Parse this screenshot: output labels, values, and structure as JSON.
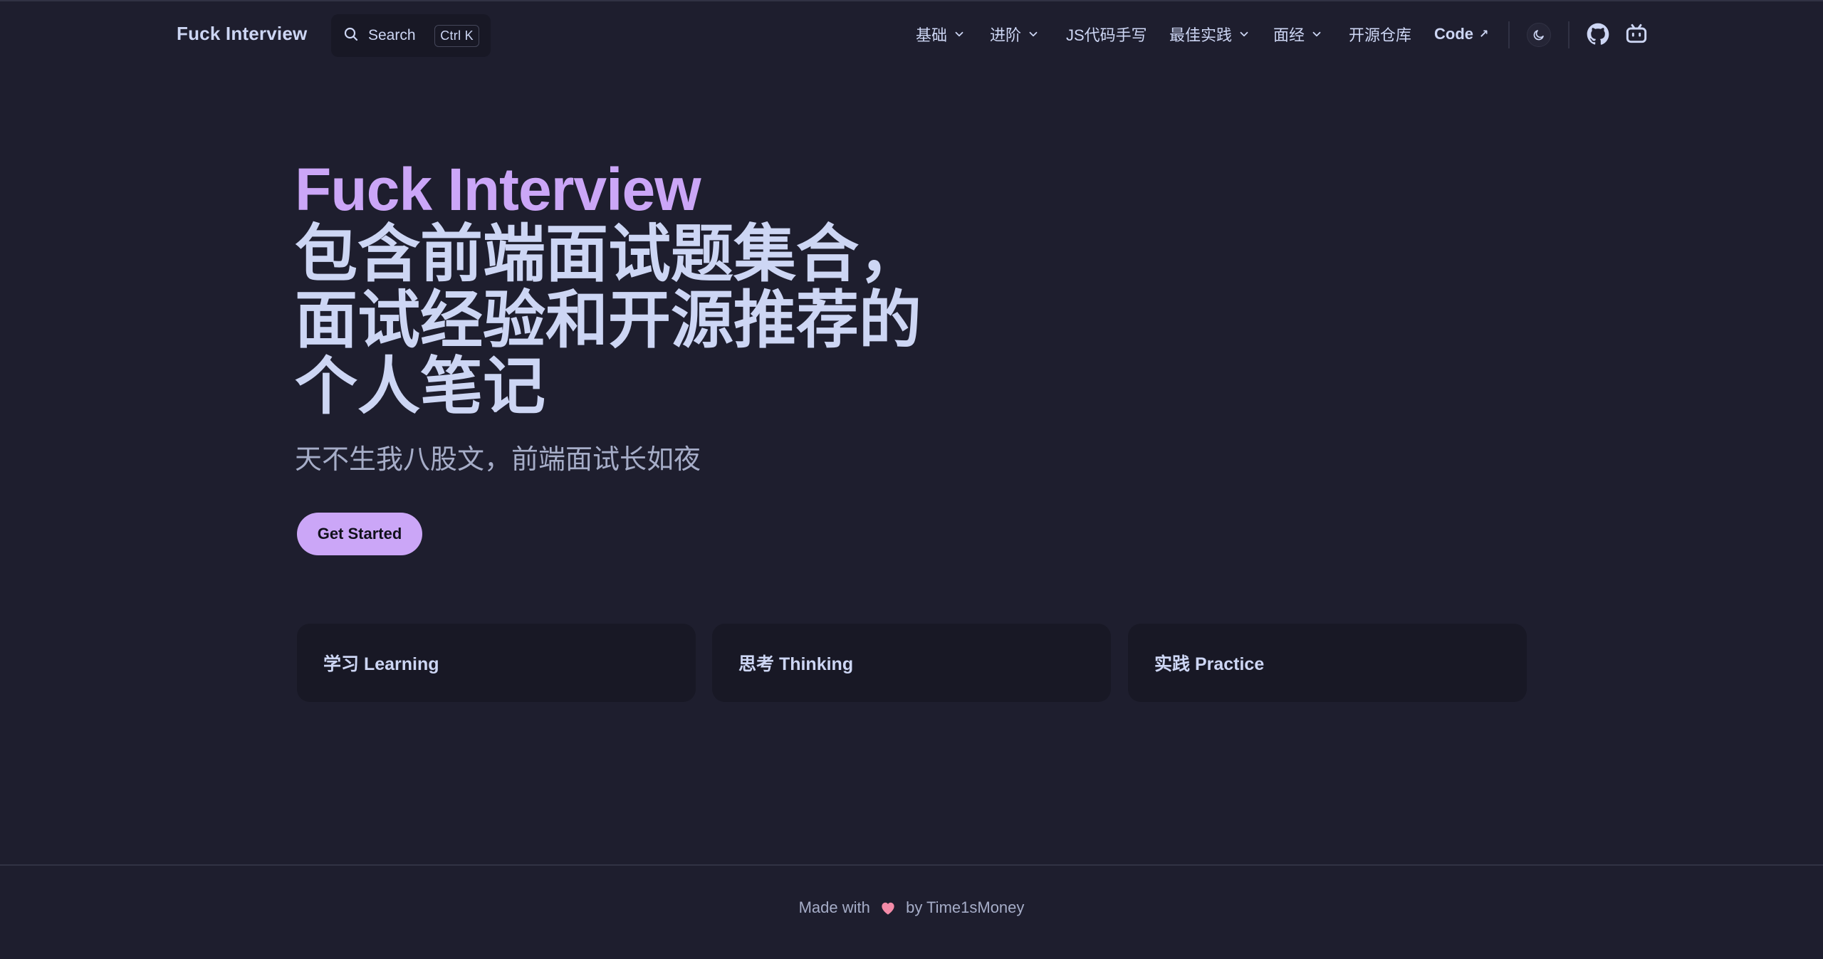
{
  "brand": "Fuck Interview",
  "search": {
    "label": "Search",
    "shortcut": "Ctrl K",
    "icon": "search-icon"
  },
  "nav": {
    "items": [
      {
        "label": "基础",
        "dropdown": true
      },
      {
        "label": "进阶",
        "dropdown": true
      },
      {
        "label": "JS代码手写",
        "dropdown": false
      },
      {
        "label": "最佳实践",
        "dropdown": true
      },
      {
        "label": "面经",
        "dropdown": true
      },
      {
        "label": "开源仓库",
        "dropdown": false
      },
      {
        "label": "Code",
        "external": true,
        "arrow": "↗"
      }
    ],
    "icons": [
      "moon-icon",
      "github-icon",
      "bilibili-icon"
    ]
  },
  "hero": {
    "name": "Fuck Interview",
    "text": "包含前端面试题集合，面试经验和开源推荐的个人笔记",
    "tagline": "天不生我八股文，前端面试长如夜",
    "action": "Get Started"
  },
  "features": [
    {
      "title": "学习 Learning"
    },
    {
      "title": "思考 Thinking"
    },
    {
      "title": "实践 Practice"
    }
  ],
  "footer": {
    "prefix": "Made with",
    "suffix": "by Time1sMoney",
    "icon": "heart-icon"
  },
  "colors": {
    "background": "#1e1e2e",
    "surface": "#181825",
    "accent": "#cba6f7",
    "text": "#cdd6f4",
    "muted": "#a6adc8",
    "heart": "#f38ba8"
  }
}
